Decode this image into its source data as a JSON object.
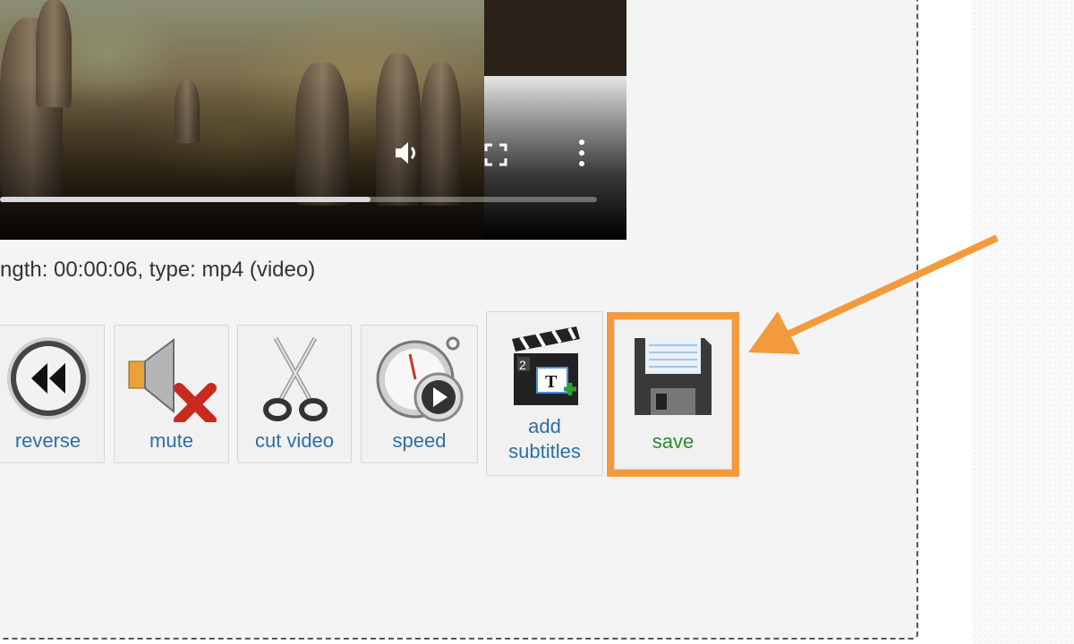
{
  "video": {
    "progress": 0.62,
    "controls": [
      "volume-icon",
      "fullscreen-icon",
      "more-options-icon"
    ]
  },
  "file_info": "ngth: 00:00:06, type: mp4 (video)",
  "tools": [
    {
      "label": "reverse",
      "icon": "reverse-icon"
    },
    {
      "label": "mute",
      "icon": "mute-icon"
    },
    {
      "label": "cut video",
      "icon": "scissors-icon"
    },
    {
      "label": "speed",
      "icon": "stopwatch-icon"
    },
    {
      "label_line1": "add",
      "label_line2": "subtitles",
      "icon": "clapperboard-icon"
    },
    {
      "label": "save",
      "icon": "floppy-disk-icon"
    }
  ],
  "colors": {
    "highlight": "#f39a3d",
    "tool_label": "#2f6ea3",
    "save_label": "#2e8b2e"
  }
}
